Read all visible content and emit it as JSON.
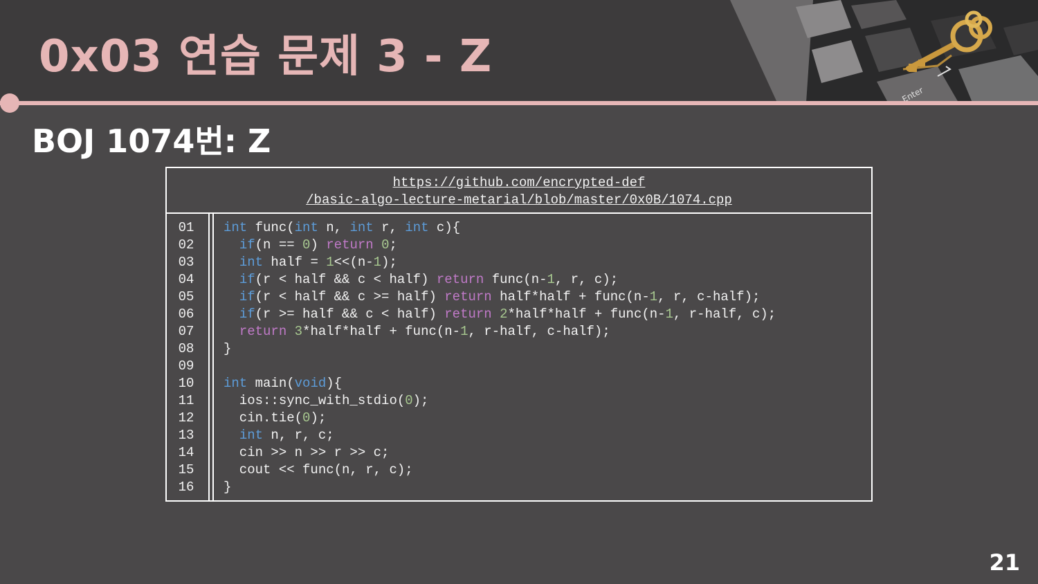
{
  "slide": {
    "title": "0x03  연습 문제 3 - Z",
    "subtitle": "BOJ 1074번: Z",
    "page_number": "21",
    "keyboard_key_label": "Enter"
  },
  "colors": {
    "background": "#4a4849",
    "header": "#3d3b3c",
    "accent": "#e6b6b6",
    "keyword": "#5d9cd8",
    "return_keyword": "#c07ac8",
    "number": "#a8c890"
  },
  "code_block": {
    "url_line1": "https://github.com/encrypted-def",
    "url_line2": "/basic-algo-lecture-metarial/blob/master/0x0B/1074.cpp",
    "line_numbers": [
      "01",
      "02",
      "03",
      "04",
      "05",
      "06",
      "07",
      "08",
      "09",
      "10",
      "11",
      "12",
      "13",
      "14",
      "15",
      "16"
    ],
    "lines": [
      [
        [
          "kw",
          "int"
        ],
        [
          "t",
          " func("
        ],
        [
          "kw",
          "int"
        ],
        [
          "t",
          " n, "
        ],
        [
          "kw",
          "int"
        ],
        [
          "t",
          " r, "
        ],
        [
          "kw",
          "int"
        ],
        [
          "t",
          " c){"
        ]
      ],
      [
        [
          "t",
          "  "
        ],
        [
          "kw",
          "if"
        ],
        [
          "t",
          "(n == "
        ],
        [
          "num",
          "0"
        ],
        [
          "t",
          ") "
        ],
        [
          "ret",
          "return"
        ],
        [
          "t",
          " "
        ],
        [
          "num",
          "0"
        ],
        [
          "t",
          ";"
        ]
      ],
      [
        [
          "t",
          "  "
        ],
        [
          "kw",
          "int"
        ],
        [
          "t",
          " half = "
        ],
        [
          "num",
          "1"
        ],
        [
          "t",
          "<<(n-"
        ],
        [
          "num",
          "1"
        ],
        [
          "t",
          ");"
        ]
      ],
      [
        [
          "t",
          "  "
        ],
        [
          "kw",
          "if"
        ],
        [
          "t",
          "(r < half && c < half) "
        ],
        [
          "ret",
          "return"
        ],
        [
          "t",
          " func(n-"
        ],
        [
          "num",
          "1"
        ],
        [
          "t",
          ", r, c);"
        ]
      ],
      [
        [
          "t",
          "  "
        ],
        [
          "kw",
          "if"
        ],
        [
          "t",
          "(r < half && c >= half) "
        ],
        [
          "ret",
          "return"
        ],
        [
          "t",
          " half*half + func(n-"
        ],
        [
          "num",
          "1"
        ],
        [
          "t",
          ", r, c-half);"
        ]
      ],
      [
        [
          "t",
          "  "
        ],
        [
          "kw",
          "if"
        ],
        [
          "t",
          "(r >= half && c < half) "
        ],
        [
          "ret",
          "return"
        ],
        [
          "t",
          " "
        ],
        [
          "num",
          "2"
        ],
        [
          "t",
          "*half*half + func(n-"
        ],
        [
          "num",
          "1"
        ],
        [
          "t",
          ", r-half, c);"
        ]
      ],
      [
        [
          "t",
          "  "
        ],
        [
          "ret",
          "return"
        ],
        [
          "t",
          " "
        ],
        [
          "num",
          "3"
        ],
        [
          "t",
          "*half*half + func(n-"
        ],
        [
          "num",
          "1"
        ],
        [
          "t",
          ", r-half, c-half);"
        ]
      ],
      [
        [
          "t",
          "}"
        ]
      ],
      [
        [
          "t",
          ""
        ]
      ],
      [
        [
          "kw",
          "int"
        ],
        [
          "t",
          " main("
        ],
        [
          "kw",
          "void"
        ],
        [
          "t",
          "){"
        ]
      ],
      [
        [
          "t",
          "  ios::sync_with_stdio("
        ],
        [
          "num",
          "0"
        ],
        [
          "t",
          ");"
        ]
      ],
      [
        [
          "t",
          "  cin.tie("
        ],
        [
          "num",
          "0"
        ],
        [
          "t",
          ");"
        ]
      ],
      [
        [
          "t",
          "  "
        ],
        [
          "kw",
          "int"
        ],
        [
          "t",
          " n, r, c;"
        ]
      ],
      [
        [
          "t",
          "  cin >> n >> r >> c;"
        ]
      ],
      [
        [
          "t",
          "  cout << func(n, r, c);"
        ]
      ],
      [
        [
          "t",
          "}"
        ]
      ]
    ]
  }
}
